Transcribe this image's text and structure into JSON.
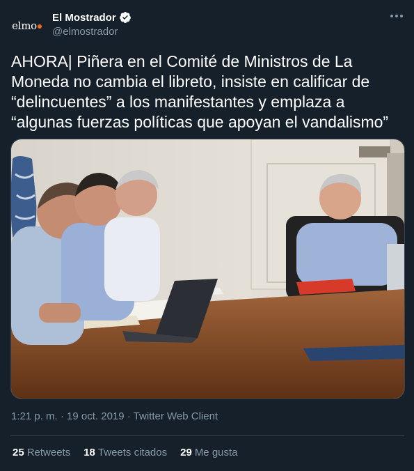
{
  "account": {
    "avatar_logo": "elmo",
    "display_name": "El Mostrador",
    "handle": "@elmostrador",
    "verified": true
  },
  "tweet": {
    "text": "AHORA| Piñera en el Comité de Ministros de La Moneda no cambia el libreto, insiste en calificar de “delincuentes” a los manifestantes y emplaza a “algunas fuerzas políticas que apoyan el vandalismo”",
    "timestamp": "1:21 p. m. · 19 oct. 2019",
    "separator": " · ",
    "client": "Twitter Web Client",
    "photo_icon": "photo-meeting"
  },
  "stats": [
    {
      "count": "25",
      "label": "Retweets"
    },
    {
      "count": "18",
      "label": "Tweets citados"
    },
    {
      "count": "29",
      "label": "Me gusta"
    }
  ],
  "colors": {
    "background": "#15202b",
    "secondary_text": "#8899a6",
    "divider": "#38444d",
    "verified": "#ffffff",
    "brand_dot": "#f26b1d"
  }
}
